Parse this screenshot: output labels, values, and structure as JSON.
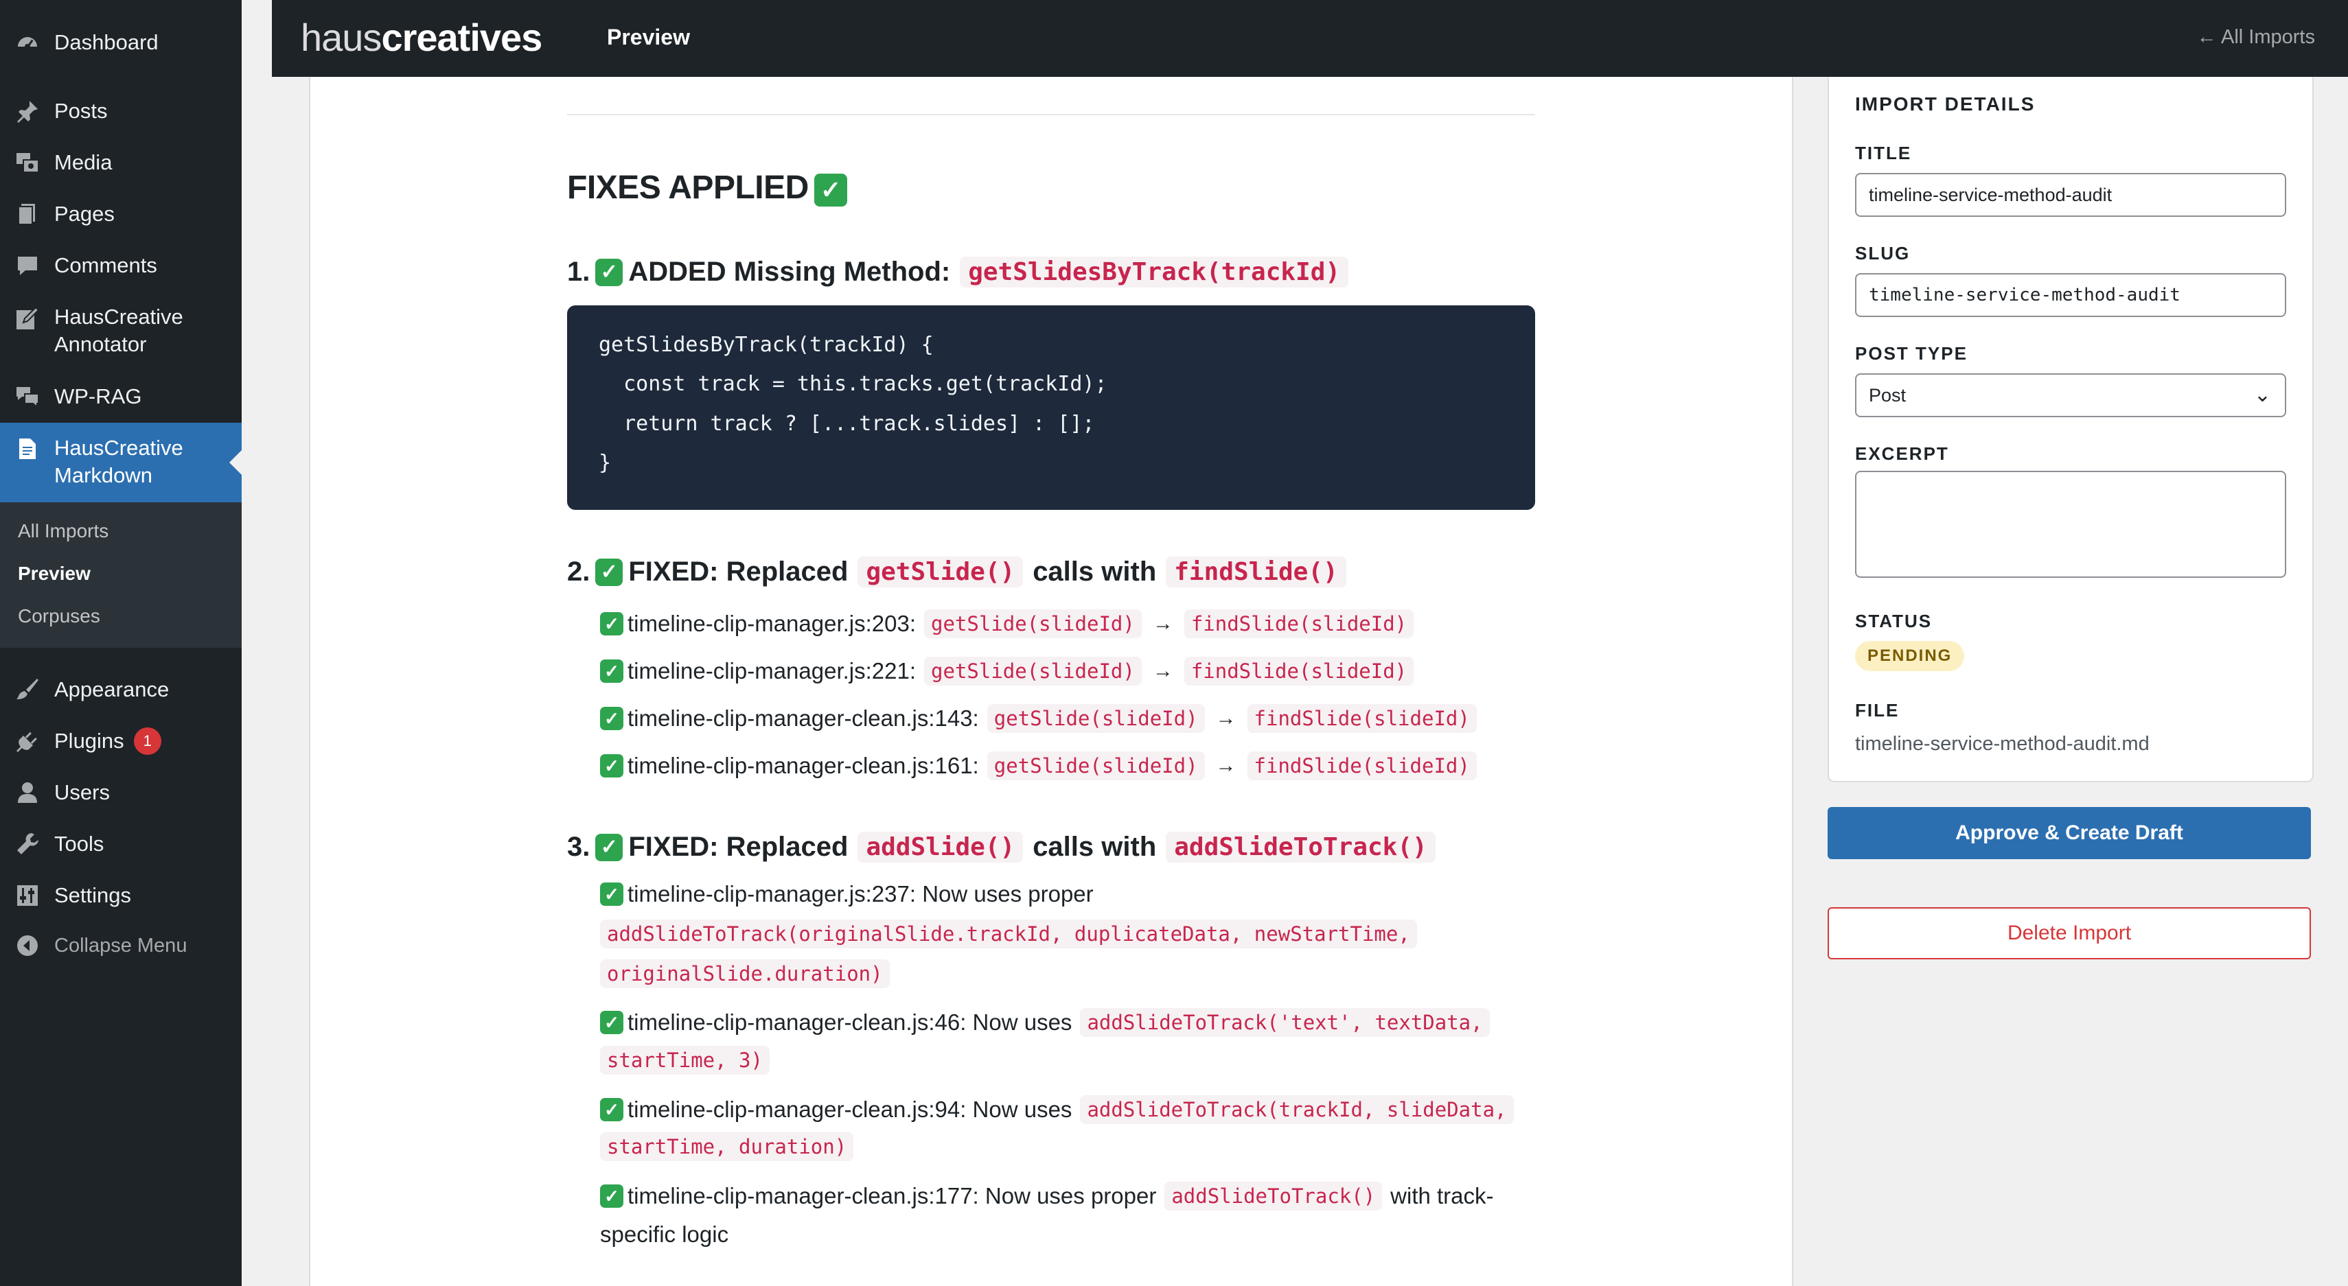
{
  "sidebar": {
    "items": [
      {
        "label": "Dashboard",
        "icon": "dashboard-icon"
      },
      {
        "label": "Posts",
        "icon": "pin-icon"
      },
      {
        "label": "Media",
        "icon": "media-icon"
      },
      {
        "label": "Pages",
        "icon": "pages-icon"
      },
      {
        "label": "Comments",
        "icon": "comment-icon"
      },
      {
        "label": "HausCreative Annotator",
        "icon": "edit-icon"
      },
      {
        "label": "WP-RAG",
        "icon": "chat-icon"
      },
      {
        "label": "HausCreative Markdown",
        "icon": "document-icon"
      },
      {
        "label": "Appearance",
        "icon": "brush-icon"
      },
      {
        "label": "Plugins",
        "icon": "plugin-icon",
        "badge": "1"
      },
      {
        "label": "Users",
        "icon": "user-icon"
      },
      {
        "label": "Tools",
        "icon": "wrench-icon"
      },
      {
        "label": "Settings",
        "icon": "settings-icon"
      },
      {
        "label": "Collapse Menu",
        "icon": "collapse-icon"
      }
    ],
    "submenu": [
      "All Imports",
      "Preview",
      "Corpuses"
    ]
  },
  "topbar": {
    "logo_light": "haus",
    "logo_bold": "creatives",
    "title": "Preview",
    "back_link": "← All Imports"
  },
  "doc": {
    "section_title": "FIXES APPLIED",
    "fix1": {
      "prefix": "1.",
      "text": "ADDED Missing Method:",
      "code": "getSlidesByTrack(trackId)",
      "codeblock": [
        "getSlidesByTrack(trackId) {",
        "  const track = this.tracks.get(trackId);",
        "  return track ? [...track.slides] : [];",
        "}"
      ]
    },
    "fix2": {
      "prefix": "2.",
      "text": "FIXED: Replaced",
      "code_a": "getSlide()",
      "mid": "calls with",
      "code_b": "findSlide()",
      "items": [
        {
          "file": "timeline-clip-manager.js:203:",
          "from": "getSlide(slideId)",
          "to": "findSlide(slideId)"
        },
        {
          "file": "timeline-clip-manager.js:221:",
          "from": "getSlide(slideId)",
          "to": "findSlide(slideId)"
        },
        {
          "file": "timeline-clip-manager-clean.js:143:",
          "from": "getSlide(slideId)",
          "to": "findSlide(slideId)"
        },
        {
          "file": "timeline-clip-manager-clean.js:161:",
          "from": "getSlide(slideId)",
          "to": "findSlide(slideId)"
        }
      ]
    },
    "fix3": {
      "prefix": "3.",
      "text": "FIXED: Replaced",
      "code_a": "addSlide()",
      "mid": "calls with",
      "code_b": "addSlideToTrack()",
      "item1": {
        "text": "timeline-clip-manager.js:237: Now uses proper",
        "code_l1": "addSlideToTrack(originalSlide.trackId, duplicateData, newStartTime,",
        "code_l2": "originalSlide.duration)"
      },
      "item2": {
        "text": "timeline-clip-manager-clean.js:46: Now uses",
        "code_l1": "addSlideToTrack('text', textData,",
        "code_l2": "startTime, 3)"
      },
      "item3": {
        "text": "timeline-clip-manager-clean.js:94: Now uses",
        "code_l1": "addSlideToTrack(trackId, slideData,",
        "code_l2": "startTime, duration)"
      },
      "item4": {
        "text": "timeline-clip-manager-clean.js:177: Now uses proper",
        "code": "addSlideToTrack()",
        "after": "with track-",
        "l2": "specific logic"
      }
    }
  },
  "details": {
    "heading": "IMPORT DETAILS",
    "title_label": "TITLE",
    "title_value": "timeline-service-method-audit",
    "slug_label": "SLUG",
    "slug_value": "timeline-service-method-audit",
    "post_type_label": "POST TYPE",
    "post_type_value": "Post",
    "excerpt_label": "EXCERPT",
    "excerpt_value": "",
    "status_label": "STATUS",
    "status_value": "PENDING",
    "file_label": "FILE",
    "file_value": "timeline-service-method-audit.md"
  },
  "actions": {
    "approve": "Approve & Create Draft",
    "delete": "Delete Import"
  },
  "colors": {
    "accent": "#2c6fb0",
    "danger": "#d63638",
    "sidebar": "#1d2327",
    "code_pink": "#c7254e",
    "check_green": "#2ea44f"
  }
}
